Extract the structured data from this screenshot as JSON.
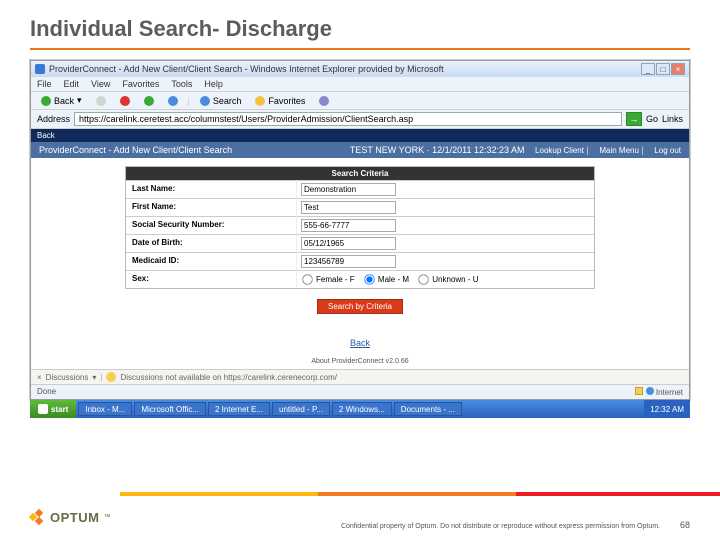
{
  "slide": {
    "title": "Individual Search- Discharge",
    "confidential": "Confidential property of Optum. Do not distribute or reproduce without express permission from Optum.",
    "page_number": "68",
    "logo_text": "OPTUM"
  },
  "browser": {
    "window_title": "ProviderConnect - Add New Client/Client Search - Windows Internet Explorer provided by Microsoft",
    "menus": [
      "File",
      "Edit",
      "View",
      "Favorites",
      "Tools",
      "Help"
    ],
    "toolbar": {
      "back": "Back",
      "search": "Search",
      "favorites": "Favorites"
    },
    "address_label": "Address",
    "address_url": "https://carelink.ceretest.acc/columnstest/Users/ProviderAdmission/ClientSearch.asp",
    "go": "Go",
    "links": "Links",
    "back_strip": "Back",
    "discussions_label": "Discussions",
    "discussions_msg": "Discussions not available on https://carelink.cerenecorp.com/",
    "status_done": "Done",
    "status_zone": "Internet"
  },
  "pc_header": {
    "title": "ProviderConnect - Add New Client/Client Search",
    "user": "TEST NEW YORK",
    "datetime": "12/1/2011 12:32:23 AM",
    "links": {
      "lookup": "Lookup Client",
      "main": "Main Menu",
      "logout": "Log out"
    }
  },
  "criteria": {
    "heading": "Search Criteria",
    "last_name_label": "Last Name:",
    "last_name_value": "Demonstration",
    "first_name_label": "First Name:",
    "first_name_value": "Test",
    "ssn_label": "Social Security Number:",
    "ssn_value": "555-66-7777",
    "dob_label": "Date of Birth:",
    "dob_value": "05/12/1965",
    "medicaid_label": "Medicaid ID:",
    "medicaid_value": "123456789",
    "sex_label": "Sex:",
    "sex_options": {
      "female": "Female - F",
      "male": "Male - M",
      "unknown": "Unknown - U"
    },
    "search_button": "Search by Criteria"
  },
  "page_links": {
    "back": "Back",
    "about": "About ProviderConnect v2.0.66"
  },
  "taskbar": {
    "start": "start",
    "items": [
      "Inbox - M...",
      "Microsoft Offic...",
      "2 Internet E...",
      "untitled - P...",
      "2 Windows...",
      "Documents - ..."
    ],
    "tray_time": "12:32 AM"
  }
}
